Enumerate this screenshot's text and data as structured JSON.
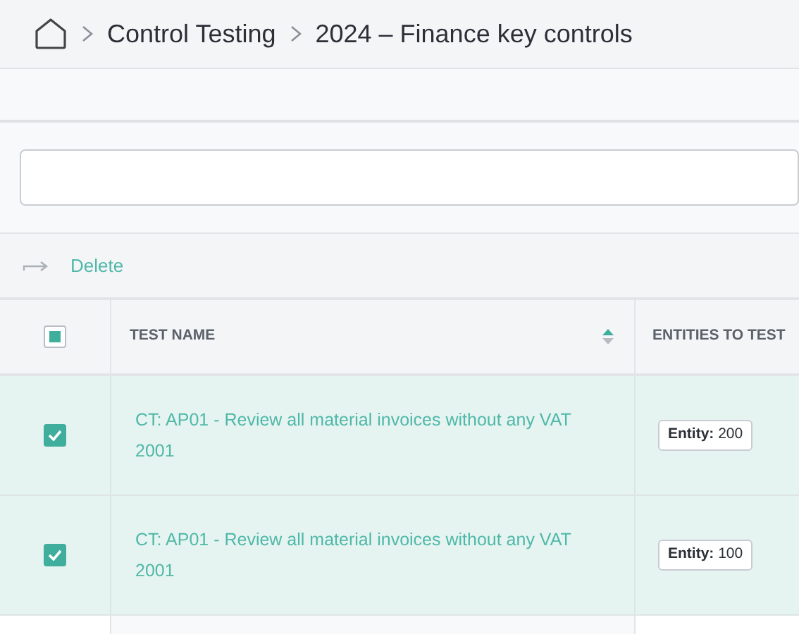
{
  "breadcrumb": [
    "Control Testing",
    "2024 – Finance key controls"
  ],
  "actions": [
    {
      "label": "Delete"
    }
  ],
  "table": {
    "select_all": {
      "indeterminate": true
    },
    "columns": [
      {
        "label": "TEST NAME",
        "sorted_ascending": true
      },
      {
        "label": "ENTITIES TO TEST",
        "sorted_ascending": false
      }
    ],
    "rows": [
      {
        "checked": true,
        "name": "CT: AP01 - Review all material invoices without any VAT 2001",
        "entity_label": "Entity:",
        "entity_value": "200"
      },
      {
        "checked": true,
        "name": "CT: AP01 - Review all material invoices without any VAT 2001",
        "entity_label": "Entity:",
        "entity_value": "100"
      }
    ]
  }
}
